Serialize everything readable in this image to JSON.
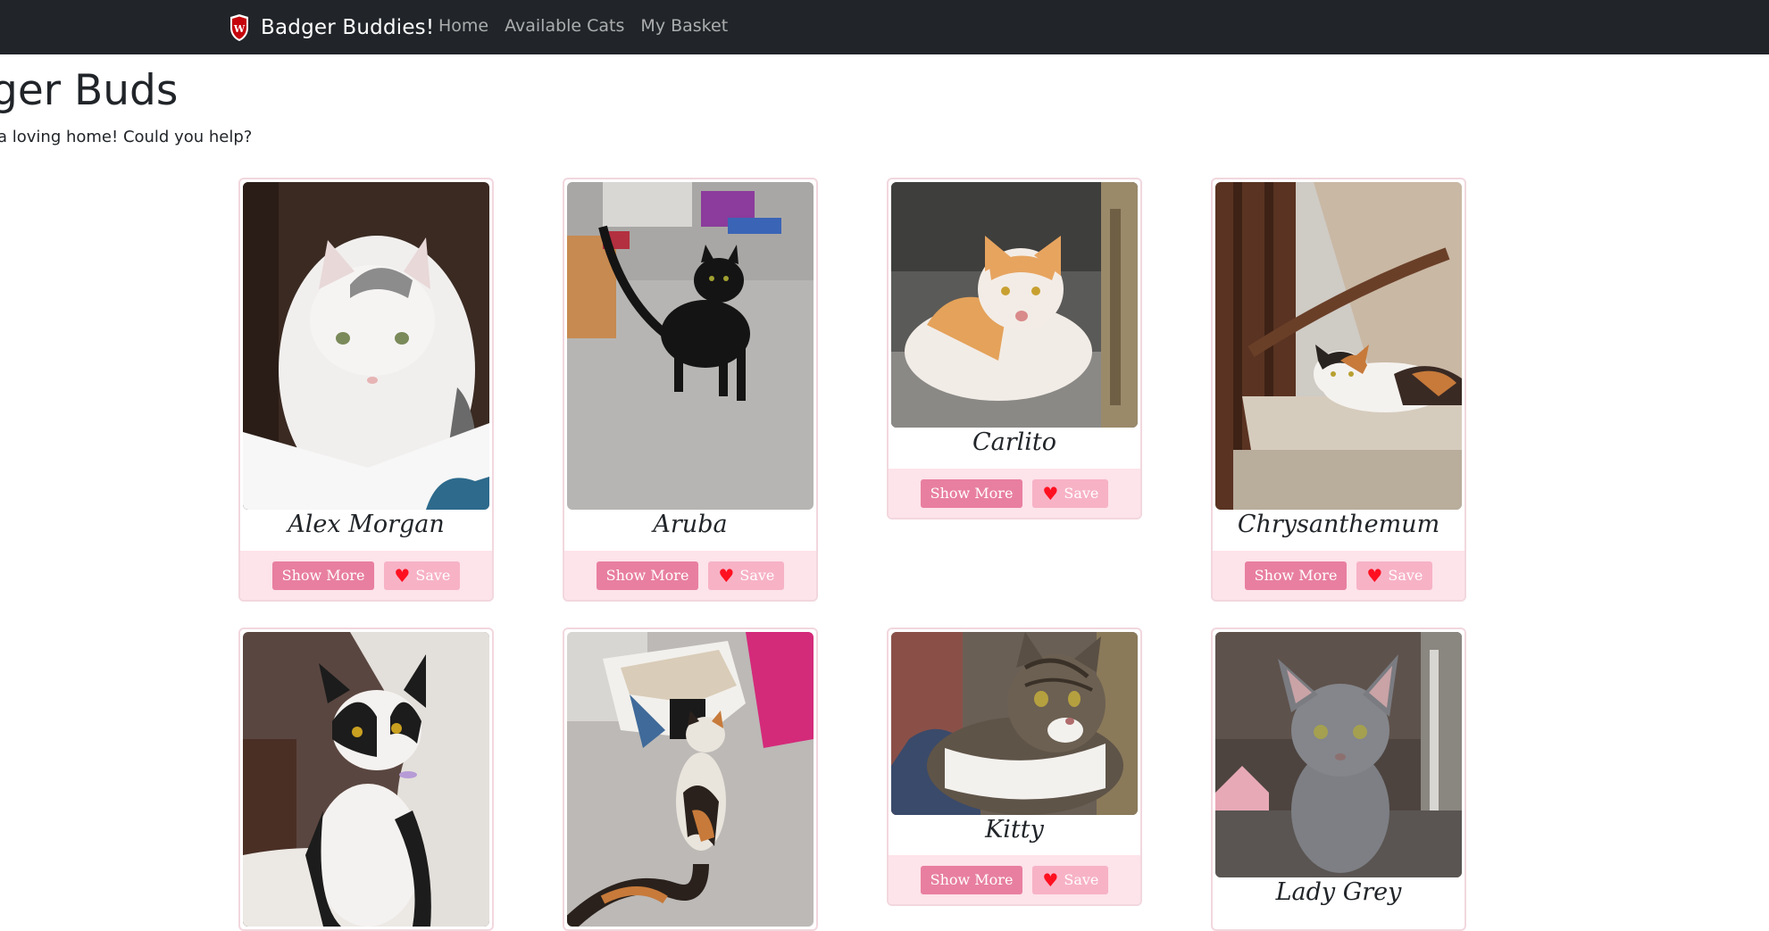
{
  "navbar": {
    "brand": "Badger Buddies!",
    "crest_letter": "W",
    "links": [
      "Home",
      "Available Cats",
      "My Basket"
    ]
  },
  "page": {
    "title": "ger Buds",
    "subtitle": "a loving home! Could you help?"
  },
  "cats": [
    {
      "name": "Alex Morgan",
      "show_more": "Show More",
      "save": "Save"
    },
    {
      "name": "Aruba",
      "show_more": "Show More",
      "save": "Save"
    },
    {
      "name": "Carlito",
      "show_more": "Show More",
      "save": "Save"
    },
    {
      "name": "Chrysanthemum",
      "show_more": "Show More",
      "save": "Save"
    },
    {
      "name": "",
      "show_more": "",
      "save": ""
    },
    {
      "name": "",
      "show_more": "",
      "save": ""
    },
    {
      "name": "Kitty",
      "show_more": "Show More",
      "save": "Save"
    },
    {
      "name": "Lady Grey",
      "show_more": "",
      "save": ""
    }
  ],
  "colors": {
    "navbar_bg": "#212529",
    "card_footer_bg": "#fde3ea",
    "show_more_bg": "#e87fa0",
    "save_bg": "#f7b2c6",
    "heart": "#ff1020"
  },
  "icons": {
    "save_icon": "heart-icon",
    "brand_icon": "crest-icon"
  }
}
